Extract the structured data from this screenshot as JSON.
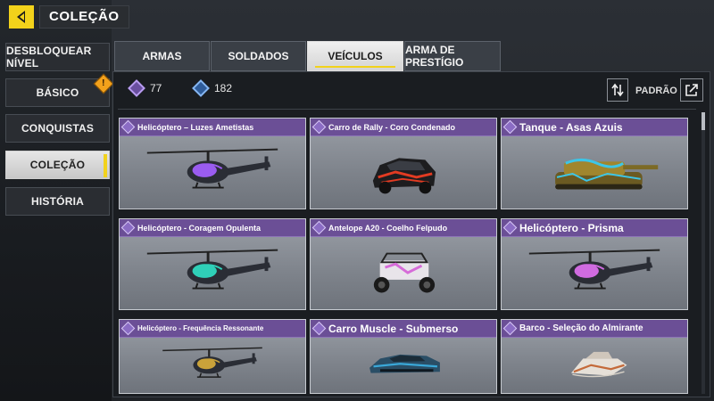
{
  "header": {
    "title": "COLEÇÃO",
    "back_icon": "back-arrow-icon"
  },
  "nav": {
    "items": [
      {
        "label": "DESBLOQUEAR NÍVEL",
        "active": false
      },
      {
        "label": "BÁSICO",
        "active": false,
        "badge": "!"
      },
      {
        "label": "CONQUISTAS",
        "active": false
      },
      {
        "label": "COLEÇÃO",
        "active": true
      },
      {
        "label": "HISTÓRIA",
        "active": false
      }
    ]
  },
  "tabs": [
    {
      "label": "ARMAS",
      "active": false
    },
    {
      "label": "SOLDADOS",
      "active": false
    },
    {
      "label": "VEÍCULOS",
      "active": true
    },
    {
      "label": "ARMA DE PRESTÍGIO",
      "active": false
    }
  ],
  "currency": {
    "purple": {
      "value": "77",
      "icon": "purple-gem-icon"
    },
    "blue": {
      "value": "182",
      "icon": "blue-gem-icon"
    }
  },
  "toolbar": {
    "sort_label": "PADRÃO",
    "sort_icon": "sort-arrows-icon",
    "share_icon": "share-icon"
  },
  "cards": [
    {
      "name": "Helicóptero – Luzes Ametistas",
      "vehicle": "helicopter",
      "accent": "#9a5cf0"
    },
    {
      "name": "Carro de Rally - Coro Condenado",
      "vehicle": "rally",
      "accent": "#e23b22"
    },
    {
      "name": "Tanque - Asas Azuis",
      "vehicle": "tank",
      "accent": "#3cc6e8"
    },
    {
      "name": "Helicóptero - Coragem Opulenta",
      "vehicle": "helicopter",
      "accent": "#2fd0b8"
    },
    {
      "name": "Antelope A20 - Coelho Felpudo",
      "vehicle": "buggy",
      "accent": "#d66bd8"
    },
    {
      "name": "Helicóptero - Prisma",
      "vehicle": "helicopter",
      "accent": "#d06be0"
    },
    {
      "name": "Helicóptero - Frequência Ressonante",
      "vehicle": "helicopter",
      "accent": "#c9a23a"
    },
    {
      "name": "Carro Muscle - Submerso",
      "vehicle": "muscle",
      "accent": "#3aa8d8"
    },
    {
      "name": "Barco - Seleção do Almirante",
      "vehicle": "boat",
      "accent": "#c46a3a"
    }
  ]
}
